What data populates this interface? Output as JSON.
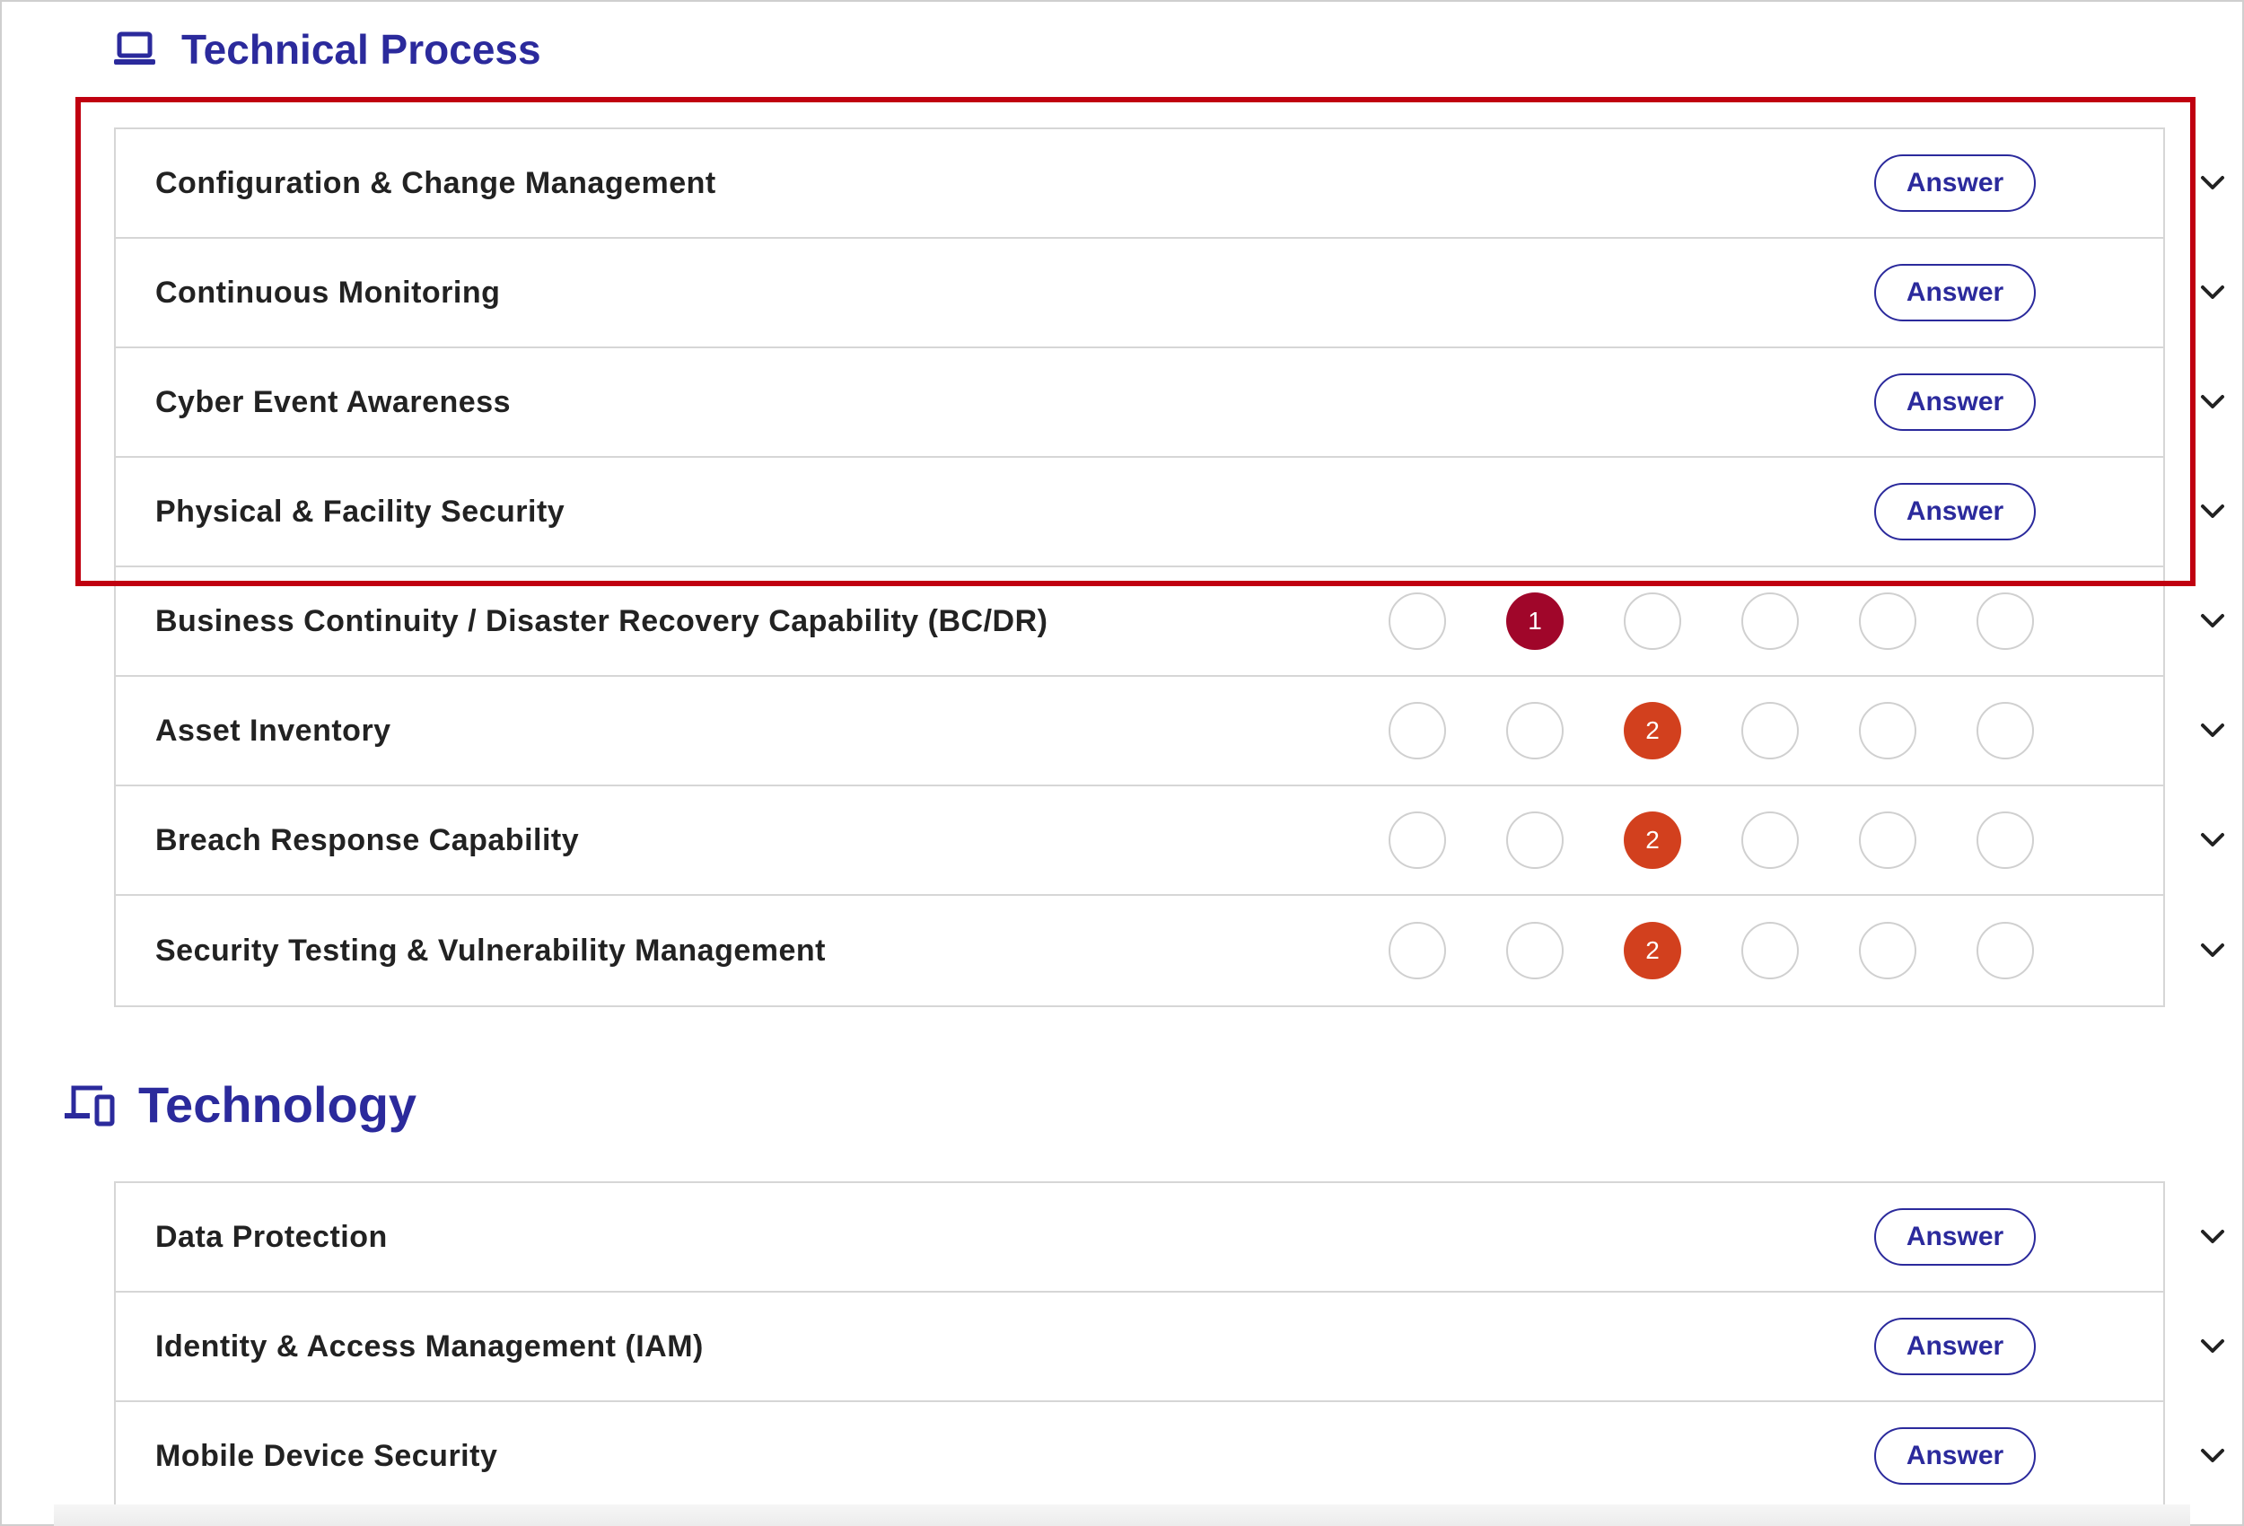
{
  "technical_process": {
    "title": "Technical Process",
    "icon": "laptop-icon",
    "answered_rows": [
      {
        "label": "Configuration & Change Management",
        "button": "Answer"
      },
      {
        "label": "Continuous Monitoring",
        "button": "Answer"
      },
      {
        "label": "Cyber Event Awareness",
        "button": "Answer"
      },
      {
        "label": "Physical & Facility Security",
        "button": "Answer"
      }
    ],
    "rated_rows": [
      {
        "label": "Business Continuity / Disaster Recovery Capability (BC/DR)",
        "score": "1",
        "score_position": 2,
        "score_color": "#a0062a"
      },
      {
        "label": "Asset Inventory",
        "score": "2",
        "score_position": 3,
        "score_color": "#d2401e"
      },
      {
        "label": "Breach Response Capability",
        "score": "2",
        "score_position": 3,
        "score_color": "#d2401e"
      },
      {
        "label": "Security Testing & Vulnerability Management",
        "score": "2",
        "score_position": 3,
        "score_color": "#d2401e"
      }
    ],
    "scale_points": 6
  },
  "technology": {
    "title": "Technology",
    "icon": "devices-icon",
    "rows": [
      {
        "label": "Data Protection",
        "button": "Answer"
      },
      {
        "label": "Identity & Access Management (IAM)",
        "button": "Answer"
      },
      {
        "label": "Mobile Device Security",
        "button": "Answer"
      }
    ]
  },
  "colors": {
    "accent": "#2b2a9c",
    "highlight": "#c00010",
    "score_dark_red": "#a0062a",
    "score_orange_red": "#d2401e"
  }
}
